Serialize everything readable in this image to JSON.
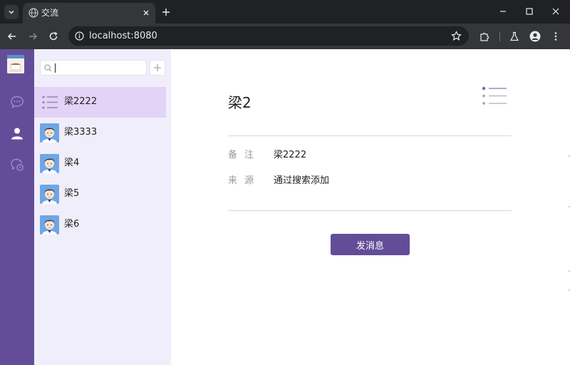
{
  "browser": {
    "tab_title": "交流",
    "url": "localhost:8080"
  },
  "search": {
    "value": "",
    "placeholder": ""
  },
  "contacts": [
    {
      "name": "梁2222",
      "active": true,
      "avatar": "list-icon"
    },
    {
      "name": "梁3333",
      "active": false,
      "avatar": "user-avatar"
    },
    {
      "name": "梁4",
      "active": false,
      "avatar": "user-avatar"
    },
    {
      "name": "梁5",
      "active": false,
      "avatar": "user-avatar"
    },
    {
      "name": "梁6",
      "active": false,
      "avatar": "user-avatar"
    }
  ],
  "detail": {
    "title": "梁2",
    "fields": [
      {
        "label": "备注",
        "value": "梁2222"
      },
      {
        "label": "来源",
        "value": "通过搜索添加"
      }
    ],
    "send_label": "发消息"
  },
  "colors": {
    "rail": "#634d98",
    "contacts_bg": "#f1eefb",
    "active_item": "#e2d3f7",
    "button": "#634d98"
  }
}
